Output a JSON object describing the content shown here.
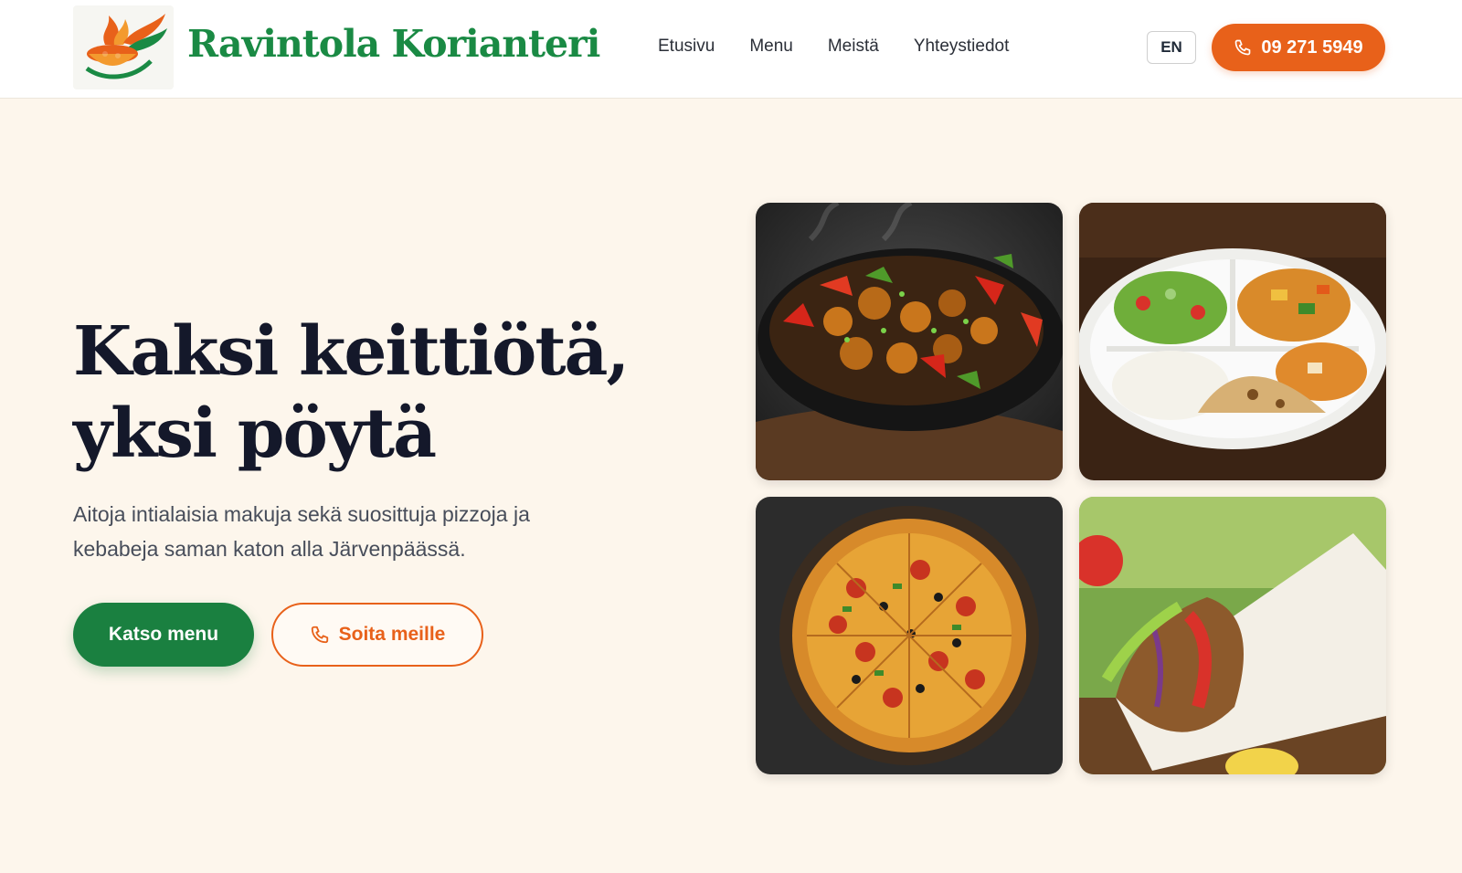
{
  "header": {
    "brand": "Ravintola Korianteri",
    "nav": [
      "Etusivu",
      "Menu",
      "Meistä",
      "Yhteystiedot"
    ],
    "lang": "EN",
    "phone": "09 271 5949",
    "logo_icon": "curry-bowl-logo-icon"
  },
  "hero": {
    "title_line1": "Kaksi keittiötä,",
    "title_line2": "yksi pöytä",
    "subtitle": "Aitoja intialaisia makuja sekä suosittuja pizzoja ja kebabeja saman katon alla Järvenpäässä.",
    "primary_button": "Katso menu",
    "secondary_button": "Soita meille"
  },
  "gallery": [
    {
      "icon": "sizzling-chicken-image"
    },
    {
      "icon": "indian-thali-image"
    },
    {
      "icon": "pizza-image"
    },
    {
      "icon": "kebab-wrap-image"
    }
  ],
  "colors": {
    "brand_green": "#1a8a44",
    "accent_orange": "#e8611a",
    "background": "#fdf6ec",
    "heading": "#14182a"
  }
}
